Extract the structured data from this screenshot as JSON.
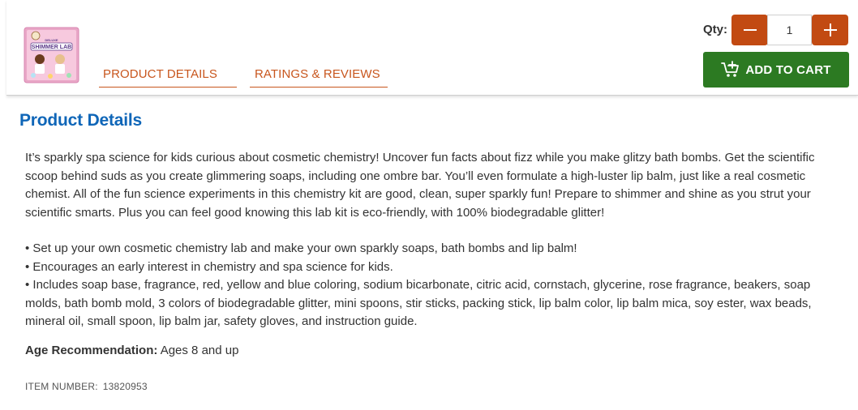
{
  "header": {
    "tabs": [
      {
        "label": "PRODUCT DETAILS"
      },
      {
        "label": "RATINGS & REVIEWS"
      }
    ],
    "product_image": {
      "alt": "Deluxe Shimmer Lab product box",
      "box_text": "SHIMMER LAB",
      "box_subtext": "DELUXE"
    },
    "qty_label": "Qty:",
    "qty_value": "1",
    "add_to_cart_label": "ADD TO CART"
  },
  "main": {
    "section_title": "Product Details",
    "description": "It’s sparkly spa science for kids curious about cosmetic chemistry! Uncover fun facts about fizz while you make glitzy bath bombs. Get the scientific scoop behind suds as you create glimmering soaps, including one ombre bar. You’ll even formulate a high-luster lip balm, just like a real cosmetic chemist. All of the fun science experiments in this chemistry kit are good, clean, super sparkly fun! Prepare to shimmer and shine as you strut your scientific smarts. Plus you can feel good knowing this lab kit is eco-friendly, with 100% biodegradable glitter!",
    "bullets": [
      "Set up your own cosmetic chemistry lab and make your own sparkly soaps, bath bombs and lip balm!",
      "Encourages an early interest in chemistry and spa science for kids.",
      "Includes soap base, fragrance, red, yellow and blue coloring, sodium bicarbonate, citric acid, cornstach, glycerine, rose fragrance, beakers, soap molds, bath bomb mold, 3 colors of biodegradable glitter, mini spoons, stir sticks, packing stick, lip balm color, lip balm mica, soy ester, wax beads, mineral oil, small spoon, lip balm jar, safety gloves, and instruction guide."
    ],
    "age_label": "Age Recommendation:",
    "age_value": "Ages 8 and up",
    "item_number_label": "ITEM NUMBER:",
    "item_number_value": "13820953"
  },
  "colors": {
    "accent_orange": "#c24a12",
    "cart_green": "#2c7a22",
    "title_blue": "#0f66b8"
  },
  "icons": {
    "minus": "minus-icon",
    "plus": "plus-icon",
    "cart": "cart-plus-icon"
  }
}
